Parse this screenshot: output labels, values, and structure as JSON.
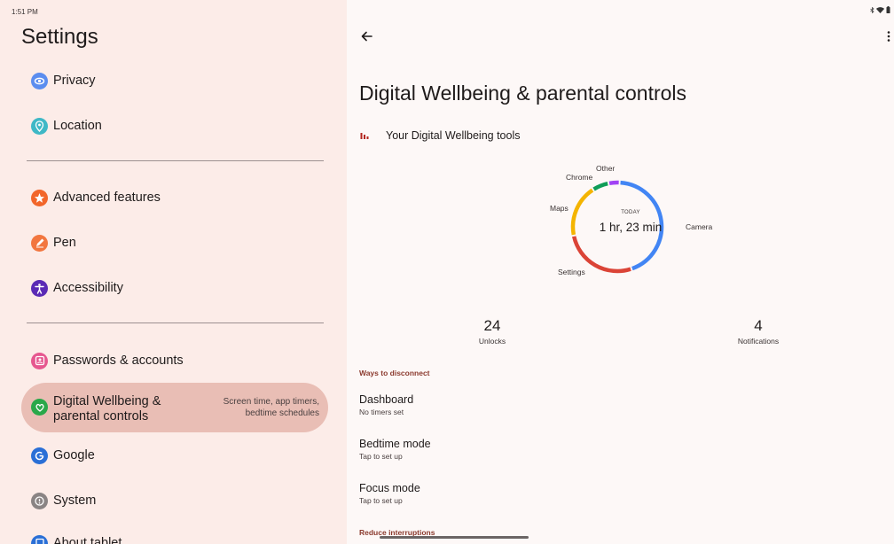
{
  "status_bar": {
    "time": "1:51 PM"
  },
  "settings": {
    "title": "Settings",
    "items": [
      {
        "label": "Privacy",
        "icon": "privacy-icon",
        "color": "#5b8def"
      },
      {
        "label": "Location",
        "icon": "location-icon",
        "color": "#3fb8c6"
      },
      {
        "label": "Advanced features",
        "icon": "star-icon",
        "color": "#f2662a"
      },
      {
        "label": "Pen",
        "icon": "pen-icon",
        "color": "#f2763f"
      },
      {
        "label": "Accessibility",
        "icon": "accessibility-icon",
        "color": "#5a2ab5"
      },
      {
        "label": "Passwords & accounts",
        "icon": "passwords-icon",
        "color": "#e6578f"
      },
      {
        "label": "Digital Wellbeing & parental controls",
        "label_line1": "Digital Wellbeing &",
        "label_line2": "parental controls",
        "sub_line1": "Screen time, app timers,",
        "sub_line2": "bedtime schedules",
        "icon": "wellbeing-icon",
        "color": "#2aa84a",
        "selected": true
      },
      {
        "label": "Google",
        "icon": "google-icon",
        "color": "#2a6fd6"
      },
      {
        "label": "System",
        "icon": "system-icon",
        "color": "#8a8484"
      },
      {
        "label": "About tablet",
        "icon": "about-icon",
        "color": "#2a6fd6"
      }
    ]
  },
  "detail": {
    "title": "Digital Wellbeing & parental controls",
    "tools_label": "Your Digital Wellbeing tools",
    "chart_center": {
      "today": "TODAY",
      "total": "1 hr, 23 min"
    },
    "stats": [
      {
        "value": "24",
        "label": "Unlocks"
      },
      {
        "value": "4",
        "label": "Notifications"
      }
    ],
    "section1": "Ways to disconnect",
    "items": [
      {
        "title": "Dashboard",
        "subtitle": "No timers set"
      },
      {
        "title": "Bedtime mode",
        "subtitle": "Tap to set up"
      },
      {
        "title": "Focus mode",
        "subtitle": "Tap to set up"
      }
    ],
    "section2": "Reduce interruptions"
  },
  "chart_data": {
    "type": "pie",
    "style": "donut",
    "categories": [
      "Camera",
      "Settings",
      "Maps",
      "Chrome",
      "Other"
    ],
    "values": [
      44,
      27,
      19,
      6,
      4
    ],
    "colors": [
      "#4285f4",
      "#db4437",
      "#f4b400",
      "#0f9d58",
      "#a142f4"
    ],
    "center_text": "1 hr, 23 min"
  }
}
